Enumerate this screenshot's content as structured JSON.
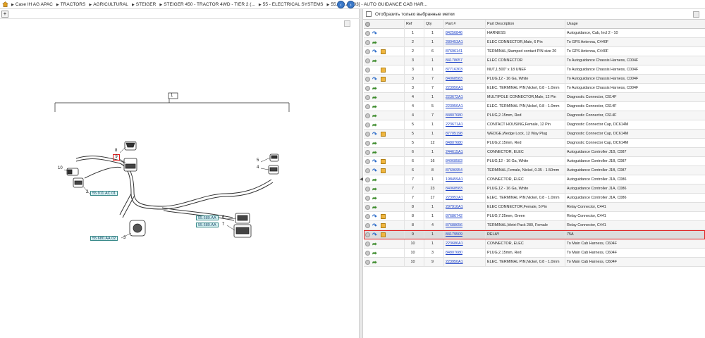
{
  "breadcrumb": [
    "Case IH AG APAC",
    "TRACTORS",
    "AGRICULTURAL",
    "STEIGER",
    "STEIGER 450 - TRACTOR 4WD - TIER 2 (...",
    "55 - ELECTRICAL SYSTEMS",
    "55.680.AA[03] - AUTO GUIDANCE CAB HAR..."
  ],
  "filter": {
    "label": "Отобразить только выбранные метки"
  },
  "columns": {
    "ref": "Ref",
    "qty": "Qty",
    "part": "Part #",
    "desc": "Part Description",
    "usage": "Usage"
  },
  "diagram": {
    "group_label": "1",
    "selected_ref": "9",
    "refs": [
      "8",
      "10",
      "2",
      "3",
      "5",
      "4",
      "6",
      "7"
    ],
    "callouts": [
      "55.911.AC.01",
      "55.680.AA",
      "55.680.AA",
      "55.680.AA.02"
    ]
  },
  "rows": [
    {
      "ref": "1",
      "qty": "1",
      "part": "84256846",
      "desc": "HARNESS",
      "usage": "Autoguidance, Cab, Incl 2 - 10",
      "arrow": "blue",
      "box": false
    },
    {
      "ref": "2",
      "qty": "1",
      "part": "280453A1",
      "desc": "ELEC CONNECTOR,Male, 6 Pin",
      "usage": "To GPS Antenna, C440F",
      "arrow": "green",
      "box": false
    },
    {
      "ref": "2",
      "qty": "6",
      "part": "87696141",
      "desc": "TERMINAL,Stamped contact PIN size 20",
      "usage": "To GPS Antenna, C440F",
      "arrow": "blue",
      "box": true
    },
    {
      "ref": "3",
      "qty": "1",
      "part": "84178657",
      "desc": "ELEC CONNECTOR",
      "usage": "To Autoguidance Chassis Harness, C004F",
      "arrow": "green",
      "box": false
    },
    {
      "ref": "3",
      "qty": "1",
      "part": "87716303",
      "desc": "NUT,1.500\" x 18 UNEF",
      "usage": "To Autoguidance Chassis Harness, C004F",
      "arrow": "none",
      "box": true
    },
    {
      "ref": "3",
      "qty": "7",
      "part": "84068583",
      "desc": "PLUG,12 - 16 Ga, White",
      "usage": "To Autoguidance Chassis Harness, C004F",
      "arrow": "blue",
      "box": true
    },
    {
      "ref": "3",
      "qty": "7",
      "part": "223950A1",
      "desc": "ELEC. TERMINAL PIN,Nickel, 0.8 - 1.0mm",
      "usage": "To Autoguidance Chassis Harness, C004F",
      "arrow": "green",
      "box": false
    },
    {
      "ref": "4",
      "qty": "1",
      "part": "223672A1",
      "desc": "MULTIPOLE CONNECTOR,Male, 12 Pin",
      "usage": "Diagnostic Connector, C614F",
      "arrow": "green",
      "box": false
    },
    {
      "ref": "4",
      "qty": "5",
      "part": "223950A1",
      "desc": "ELEC. TERMINAL PIN,Nickel, 0.8 - 1.0mm",
      "usage": "Diagnostic Connector, C614F",
      "arrow": "green",
      "box": false
    },
    {
      "ref": "4",
      "qty": "7",
      "part": "84807680",
      "desc": "PLUG,2.15mm, Red",
      "usage": "Diagnostic Connector, C614F",
      "arrow": "green",
      "box": false
    },
    {
      "ref": "5",
      "qty": "1",
      "part": "223671A1",
      "desc": "CONTACT HOUSING,Female, 12 Pin",
      "usage": "Diagnostic Connector Cap, DC614M",
      "arrow": "green",
      "box": false
    },
    {
      "ref": "5",
      "qty": "1",
      "part": "87705198",
      "desc": "WEDGE,Wedge Lock, 12 Way Plug",
      "usage": "Diagnostic Connector Cap, DC614M",
      "arrow": "blue",
      "box": true
    },
    {
      "ref": "5",
      "qty": "12",
      "part": "84807680",
      "desc": "PLUG,2.15mm, Red",
      "usage": "Diagnostic Connector Cap, DC614M",
      "arrow": "green",
      "box": false
    },
    {
      "ref": "6",
      "qty": "1",
      "part": "244615A1",
      "desc": "CONNECTOR, ELEC",
      "usage": "Autoguidance Controller J1B, C087",
      "arrow": "green",
      "box": false
    },
    {
      "ref": "6",
      "qty": "16",
      "part": "84068583",
      "desc": "PLUG,12 - 16 Ga, White",
      "usage": "Autoguidance Controller J1B, C087",
      "arrow": "blue",
      "box": true
    },
    {
      "ref": "6",
      "qty": "8",
      "part": "87696954",
      "desc": "TERMINAL,Female, Nickel, 0.35 - 1.50mm",
      "usage": "Autoguidance Controller J1B, C087",
      "arrow": "blue",
      "box": true
    },
    {
      "ref": "7",
      "qty": "1",
      "part": "198459A1",
      "desc": "CONNECTOR, ELEC",
      "usage": "Autoguidance Controller J1A, C086",
      "arrow": "green",
      "box": false
    },
    {
      "ref": "7",
      "qty": "23",
      "part": "84068583",
      "desc": "PLUG,12 - 16 Ga, White",
      "usage": "Autoguidance Controller J1A, C086",
      "arrow": "green",
      "box": false
    },
    {
      "ref": "7",
      "qty": "17",
      "part": "223952A1",
      "desc": "ELEC. TERMINAL PIN,Nickel, 0.8 - 1.0mm",
      "usage": "Autoguidance Controller J1A, C086",
      "arrow": "green",
      "box": false
    },
    {
      "ref": "8",
      "qty": "1",
      "part": "297910A1",
      "desc": "ELEC CONNECTOR,Female, 5 Pin",
      "usage": "Relay Connector, C441",
      "arrow": "green",
      "box": false
    },
    {
      "ref": "8",
      "qty": "1",
      "part": "87686742",
      "desc": "PLUG,7.25mm, Green",
      "usage": "Relay Connector, C441",
      "arrow": "blue",
      "box": true
    },
    {
      "ref": "8",
      "qty": "4",
      "part": "87688656",
      "desc": "TERMINAL,Metri-Pack 280, Female",
      "usage": "Relay Connector, C441",
      "arrow": "blue",
      "box": true
    },
    {
      "ref": "9",
      "qty": "1",
      "part": "84179509",
      "desc": "RELAY",
      "usage": "75A",
      "arrow": "blue",
      "box": true,
      "selected": true
    },
    {
      "ref": "10",
      "qty": "1",
      "part": "223686A1",
      "desc": "CONNECTOR, ELEC",
      "usage": "To Main Cab Harness, C604F",
      "arrow": "green",
      "box": false
    },
    {
      "ref": "10",
      "qty": "3",
      "part": "84807680",
      "desc": "PLUG,2.15mm, Red",
      "usage": "To Main Cab Harness, C604F",
      "arrow": "green",
      "box": false
    },
    {
      "ref": "10",
      "qty": "9",
      "part": "223950A1",
      "desc": "ELEC. TERMINAL PIN,Nickel, 0.8 - 1.0mm",
      "usage": "To Main Cab Harness, C604F",
      "arrow": "green",
      "box": false
    }
  ],
  "colors": {
    "accent": "#3a78c8",
    "link": "#1a3fc8",
    "highlight": "#e02020",
    "callout_bg": "#d8f3f3"
  }
}
